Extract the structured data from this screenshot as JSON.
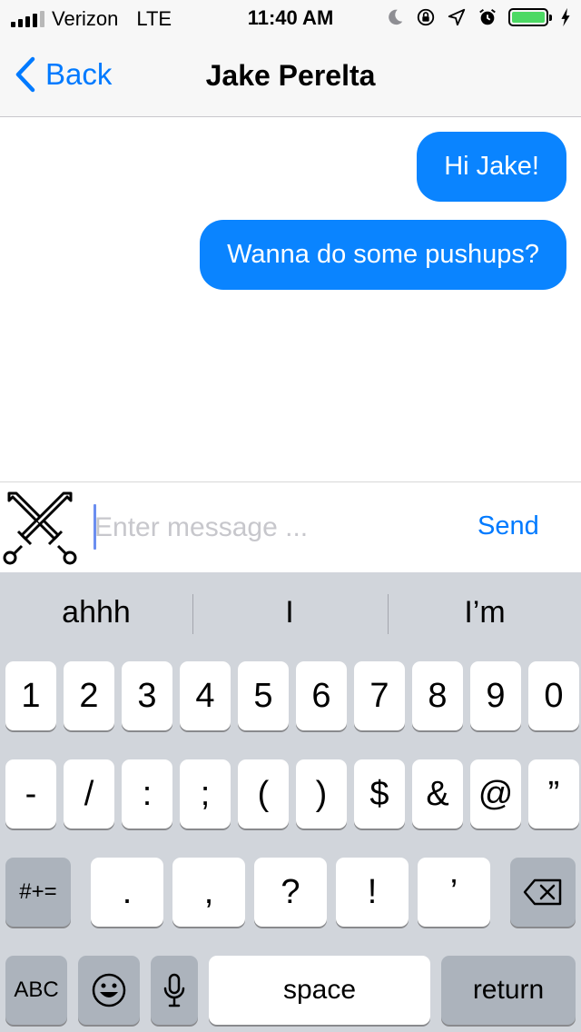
{
  "status_bar": {
    "carrier": "Verizon",
    "network": "LTE",
    "time": "11:40 AM",
    "icons": [
      "moon-icon",
      "orientation-lock-icon",
      "location-icon",
      "alarm-icon",
      "battery-icon",
      "charging-icon"
    ],
    "battery_color": "#4cd964"
  },
  "nav": {
    "back_label": "Back",
    "title": "Jake Perelta"
  },
  "messages": [
    {
      "text": "Hi Jake!",
      "sender": "me"
    },
    {
      "text": "Wanna do some pushups?",
      "sender": "me"
    }
  ],
  "input": {
    "placeholder": "Enter message ...",
    "value": "",
    "send_label": "Send",
    "avatar_icon": "crossed-swords-icon"
  },
  "keyboard": {
    "suggestions": [
      "ahhh",
      "I",
      "I’m"
    ],
    "row1": [
      "1",
      "2",
      "3",
      "4",
      "5",
      "6",
      "7",
      "8",
      "9",
      "0"
    ],
    "row2": [
      "-",
      "/",
      ":",
      ";",
      "(",
      ")",
      "$",
      "&",
      "@",
      "”"
    ],
    "row3": {
      "shift": "#+=",
      "keys": [
        ".",
        ",",
        "?",
        "!",
        "’"
      ],
      "delete_icon": "backspace-icon"
    },
    "row4": {
      "abc": "ABC",
      "emoji_icon": "emoji-icon",
      "mic_icon": "microphone-icon",
      "space": "space",
      "return": "return"
    }
  },
  "colors": {
    "accent": "#007aff",
    "bubble": "#0a84ff",
    "keyboard_bg": "#d1d5db",
    "dark_key": "#acb3bc"
  }
}
